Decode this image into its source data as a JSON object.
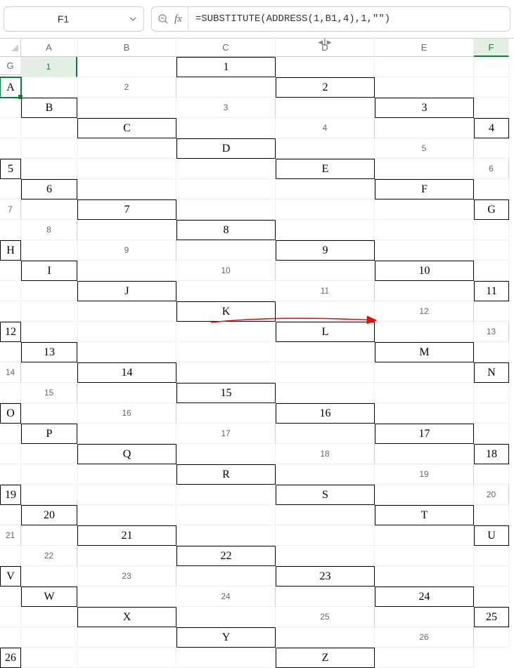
{
  "nameBox": {
    "value": "F1"
  },
  "formulaBar": {
    "formula": "=SUBSTITUTE(ADDRESS(1,B1,4),1,\"\")"
  },
  "columns": [
    "A",
    "B",
    "C",
    "D",
    "E",
    "F",
    "G"
  ],
  "selectedColumn": "F",
  "selectedRow": "1",
  "activeCell": {
    "row": 1,
    "col": "F"
  },
  "rows": [
    {
      "num": "1",
      "B": "1",
      "F": "A"
    },
    {
      "num": "2",
      "B": "2",
      "F": "B"
    },
    {
      "num": "3",
      "B": "3",
      "F": "C"
    },
    {
      "num": "4",
      "B": "4",
      "F": "D"
    },
    {
      "num": "5",
      "B": "5",
      "F": "E"
    },
    {
      "num": "6",
      "B": "6",
      "F": "F"
    },
    {
      "num": "7",
      "B": "7",
      "F": "G"
    },
    {
      "num": "8",
      "B": "8",
      "F": "H"
    },
    {
      "num": "9",
      "B": "9",
      "F": "I"
    },
    {
      "num": "10",
      "B": "10",
      "F": "J"
    },
    {
      "num": "11",
      "B": "11",
      "F": "K"
    },
    {
      "num": "12",
      "B": "12",
      "F": "L"
    },
    {
      "num": "13",
      "B": "13",
      "F": "M"
    },
    {
      "num": "14",
      "B": "14",
      "F": "N"
    },
    {
      "num": "15",
      "B": "15",
      "F": "O"
    },
    {
      "num": "16",
      "B": "16",
      "F": "P"
    },
    {
      "num": "17",
      "B": "17",
      "F": "Q"
    },
    {
      "num": "18",
      "B": "18",
      "F": "R"
    },
    {
      "num": "19",
      "B": "19",
      "F": "S"
    },
    {
      "num": "20",
      "B": "20",
      "F": "T"
    },
    {
      "num": "21",
      "B": "21",
      "F": "U"
    },
    {
      "num": "22",
      "B": "22",
      "F": "V"
    },
    {
      "num": "23",
      "B": "23",
      "F": "W"
    },
    {
      "num": "24",
      "B": "24",
      "F": "X"
    },
    {
      "num": "25",
      "B": "25",
      "F": "Y"
    },
    {
      "num": "26",
      "B": "26",
      "F": "Z"
    }
  ]
}
